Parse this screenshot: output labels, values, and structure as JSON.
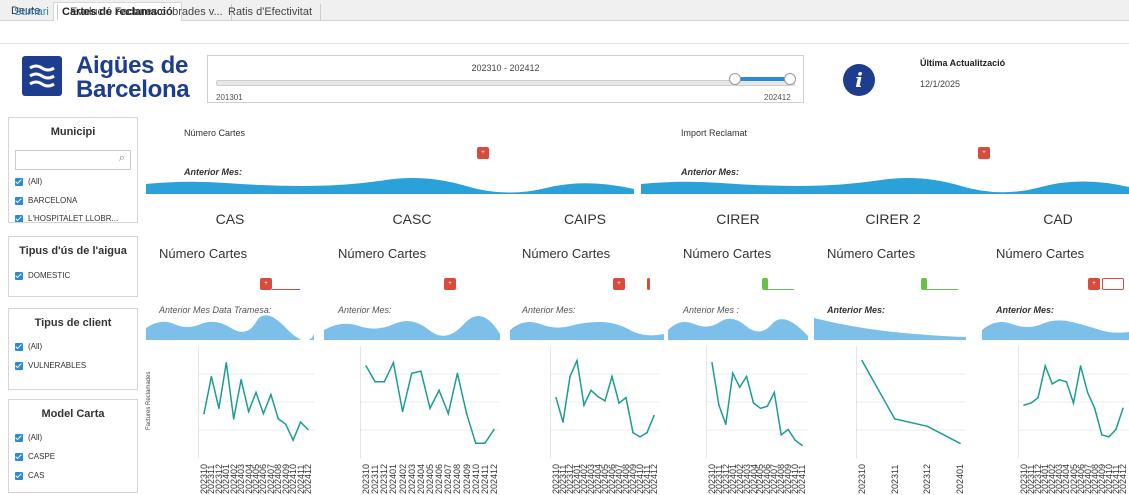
{
  "tabs": [
    {
      "label": "Deute",
      "active": false
    },
    {
      "label": "Cartes de reclamació",
      "active": true
    }
  ],
  "subtabs": [
    {
      "label": "Sumari",
      "active": true
    },
    {
      "label": "Evolució Factures cobrades v...",
      "active": false
    },
    {
      "label": "Ratis d'Efectivitat",
      "active": false
    }
  ],
  "logo": {
    "line1": "Aigües de",
    "line2": "Barcelona"
  },
  "slider": {
    "range": "202310 - 202412",
    "min": "201301",
    "max": "202412"
  },
  "info_icon": "info-icon",
  "update": {
    "label": "Última Actualització",
    "date": "12/1/2025"
  },
  "filters": {
    "municipi": {
      "title": "Municipi",
      "items": [
        "(All)",
        "BARCELONA",
        "L'HOSPITALET LLOBR..."
      ]
    },
    "tipus_us": {
      "title": "Tipus d'ús de l'aigua",
      "items": [
        "DOMESTIC"
      ]
    },
    "tipus_client": {
      "title": "Tipus de client",
      "items": [
        "(All)",
        "VULNERABLES"
      ]
    },
    "model_carta": {
      "title": "Model Carta",
      "items": [
        "(All)",
        "CASPE",
        "CAS"
      ]
    }
  },
  "kpis": {
    "left": {
      "title": "Número Cartes",
      "anterior": "Anterior Mes:"
    },
    "right": {
      "title": "Import Reclamat",
      "anterior": "Anterior Mes:"
    }
  },
  "columns": [
    {
      "name": "CAS",
      "label": "Número Cartes",
      "anterior": "Anterior Mes Data Tramesa:"
    },
    {
      "name": "CASC",
      "label": "Número Cartes",
      "anterior": "Anterior Mes:"
    },
    {
      "name": "CAIPS",
      "label": "Número Cartes",
      "anterior": "Anterior Mes:"
    },
    {
      "name": "CIRER",
      "label": "Número Cartes",
      "anterior": "Anterior Mes :"
    },
    {
      "name": "CIRER 2",
      "label": "Número Cartes",
      "anterior": "Anterior Mes:"
    },
    {
      "name": "CAD",
      "label": "Número Cartes",
      "anterior": "Anterior Mes:"
    }
  ],
  "colors": {
    "accent": "#2a8ad9",
    "line": "#1b9e8f",
    "area": "#7cc0ea",
    "brand": "#1f3d8f",
    "red": "#d94c3d",
    "green": "#6abf4b"
  },
  "chart_data": [
    {
      "type": "line",
      "title": "CAS",
      "ylabel": "Factures Reclamades",
      "x": [
        "202310",
        "202311",
        "202312",
        "202401",
        "202402",
        "202403",
        "202404",
        "202405",
        "202406",
        "202407",
        "202408",
        "202409",
        "202410",
        "202411",
        "202412"
      ],
      "values": [
        40,
        75,
        45,
        88,
        35,
        72,
        42,
        60,
        40,
        58,
        35,
        30,
        15,
        32,
        25
      ]
    },
    {
      "type": "line",
      "title": "CASC",
      "x": [
        "202310",
        "202311",
        "202312",
        "202401",
        "202402",
        "202403",
        "202404",
        "202405",
        "202406",
        "202407",
        "202408",
        "202409",
        "202410",
        "202411",
        "202412"
      ],
      "values": [
        85,
        70,
        70,
        88,
        42,
        78,
        80,
        45,
        62,
        40,
        78,
        40,
        12,
        12,
        25
      ]
    },
    {
      "type": "line",
      "title": "CAIPS",
      "x": [
        "202310",
        "202311",
        "202312",
        "202401",
        "202402",
        "202403",
        "202404",
        "202405",
        "202406",
        "202407",
        "202408",
        "202409",
        "202410",
        "202411",
        "202412"
      ],
      "values": [
        55,
        32,
        75,
        90,
        48,
        62,
        56,
        52,
        75,
        50,
        55,
        22,
        18,
        22,
        38
      ]
    },
    {
      "type": "line",
      "title": "CIRER",
      "x": [
        "202310",
        "202311",
        "202312",
        "202401",
        "202402",
        "202403",
        "202404",
        "202405",
        "202406",
        "202407",
        "202408",
        "202409",
        "202410",
        "202411"
      ],
      "values": [
        88,
        48,
        30,
        78,
        65,
        75,
        50,
        45,
        47,
        60,
        20,
        25,
        15,
        10
      ]
    },
    {
      "type": "line",
      "title": "CIRER 2",
      "x": [
        "202310",
        "202311",
        "202312",
        "202401"
      ],
      "values": [
        90,
        35,
        28,
        12
      ]
    },
    {
      "type": "line",
      "title": "CAD",
      "x": [
        "202310",
        "202311",
        "202312",
        "202401",
        "202402",
        "202403",
        "202404",
        "202405",
        "202406",
        "202407",
        "202408",
        "202409",
        "202410",
        "202411",
        "202412"
      ],
      "values": [
        48,
        50,
        55,
        85,
        68,
        72,
        70,
        50,
        85,
        60,
        45,
        20,
        18,
        25,
        45
      ]
    }
  ]
}
